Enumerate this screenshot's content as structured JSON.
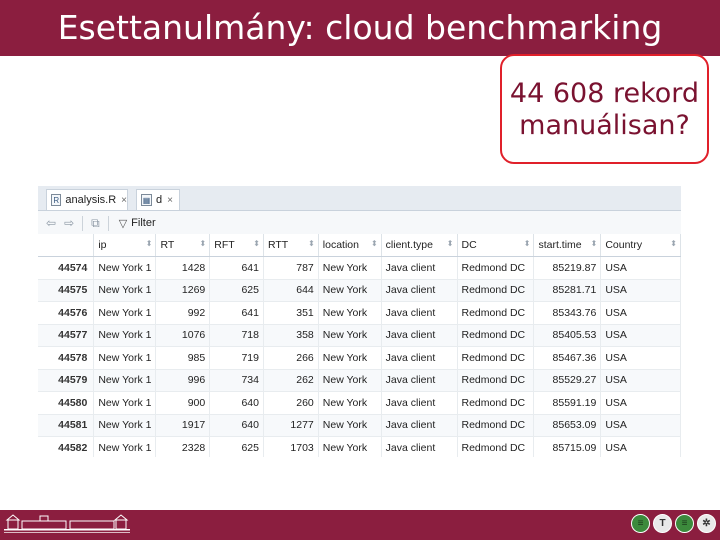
{
  "slide": {
    "title": "Esettanulmány: cloud benchmarking",
    "callout": [
      "44 608 rekord",
      "manuálisan?"
    ],
    "colors": {
      "accent": "#8b1e3f",
      "callout_border": "#e0202a",
      "callout_text": "#7a1230"
    }
  },
  "viewer": {
    "tabs": [
      {
        "label": "analysis.R",
        "icon": "r-script-icon"
      },
      {
        "label": "d",
        "icon": "table-icon"
      }
    ],
    "toolbar": {
      "filter_label": "Filter"
    },
    "columns": [
      "",
      "ip",
      "RT",
      "RFT",
      "RTT",
      "location",
      "client.type",
      "DC",
      "start.time",
      "Country"
    ],
    "rows": [
      [
        "44574",
        "New York 1",
        "1428",
        "641",
        "787",
        "New York",
        "Java client",
        "Redmond DC",
        "85219.87",
        "USA"
      ],
      [
        "44575",
        "New York 1",
        "1269",
        "625",
        "644",
        "New York",
        "Java client",
        "Redmond DC",
        "85281.71",
        "USA"
      ],
      [
        "44576",
        "New York 1",
        "992",
        "641",
        "351",
        "New York",
        "Java client",
        "Redmond DC",
        "85343.76",
        "USA"
      ],
      [
        "44577",
        "New York 1",
        "1076",
        "718",
        "358",
        "New York",
        "Java client",
        "Redmond DC",
        "85405.53",
        "USA"
      ],
      [
        "44578",
        "New York 1",
        "985",
        "719",
        "266",
        "New York",
        "Java client",
        "Redmond DC",
        "85467.36",
        "USA"
      ],
      [
        "44579",
        "New York 1",
        "996",
        "734",
        "262",
        "New York",
        "Java client",
        "Redmond DC",
        "85529.27",
        "USA"
      ],
      [
        "44580",
        "New York 1",
        "900",
        "640",
        "260",
        "New York",
        "Java client",
        "Redmond DC",
        "85591.19",
        "USA"
      ],
      [
        "44581",
        "New York 1",
        "1917",
        "640",
        "1277",
        "New York",
        "Java client",
        "Redmond DC",
        "85653.09",
        "USA"
      ],
      [
        "44582",
        "New York 1",
        "2328",
        "625",
        "1703",
        "New York",
        "Java client",
        "Redmond DC",
        "85715.09",
        "USA"
      ]
    ]
  },
  "footer": {
    "logo": "university-building-logo",
    "icons": [
      "footer-badge-icon",
      "footer-t-icon",
      "footer-list-icon",
      "footer-gear-icon"
    ]
  }
}
